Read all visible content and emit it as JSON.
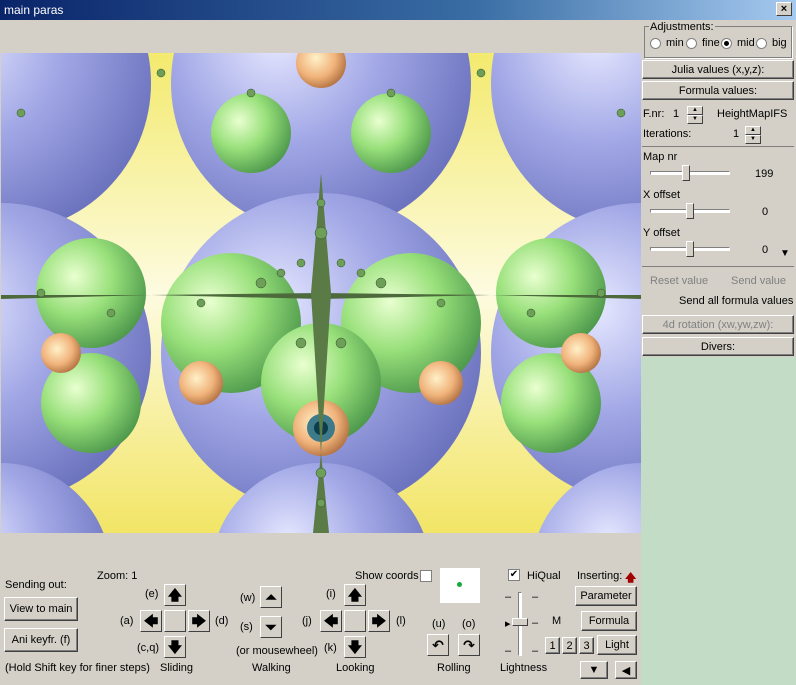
{
  "window": {
    "title": "main paras",
    "close_icon": "×"
  },
  "adjustments": {
    "label": "Adjustments:",
    "options": [
      "min",
      "fine",
      "mid",
      "big"
    ],
    "selected": "mid"
  },
  "panels": {
    "julia": "Julia values (x,y,z):",
    "formula": "Formula values:",
    "rotation": "4d rotation (xw,yw,zw):",
    "divers": "Divers:"
  },
  "formula": {
    "fnr_label": "F.nr:",
    "fnr_value": "1",
    "name": "HeightMapIFS",
    "iterations_label": "Iterations:",
    "iterations_value": "1",
    "params": [
      {
        "label": "Map nr",
        "value": "199",
        "pos": 0.45
      },
      {
        "label": "X offset",
        "value": "0",
        "pos": 0.5
      },
      {
        "label": "Y offset",
        "value": "0",
        "pos": 0.5
      }
    ],
    "reset": "Reset value",
    "send": "Send value",
    "send_all": "Send all formula values"
  },
  "bottom": {
    "sending_out": "Sending out:",
    "view_to_main": "View to main",
    "ani_keyfr": "Ani keyfr. (f)",
    "hold_shift": "(Hold Shift key for finer steps)",
    "zoom": "Zoom: 1",
    "show_coords": "Show coords",
    "sliding": "Sliding",
    "walking": "Walking",
    "looking": "Looking",
    "rolling": "Rolling",
    "lightness": "Lightness",
    "mousewheel": "(or mousewheel)",
    "keys": {
      "e": "(e)",
      "a": "(a)",
      "d": "(d)",
      "cq": "(c,q)",
      "w": "(w)",
      "s": "(s)",
      "i": "(i)",
      "j": "(j)",
      "l": "(l)",
      "k": "(k)",
      "u": "(u)",
      "o": "(o)"
    },
    "hiqual": "HiQual",
    "hiqual_checked": true,
    "inserting": "Inserting:",
    "m": "M",
    "parameter": "Parameter",
    "formula_btn": "Formula",
    "light": "Light",
    "nums": [
      "1",
      "2",
      "3"
    ],
    "dash": "–"
  },
  "colors": {
    "fractal_yellow": "#f6ee7a",
    "fractal_blue": "#9aa3e0",
    "fractal_green": "#9be07a",
    "green_panel": "#c3dcc5"
  }
}
